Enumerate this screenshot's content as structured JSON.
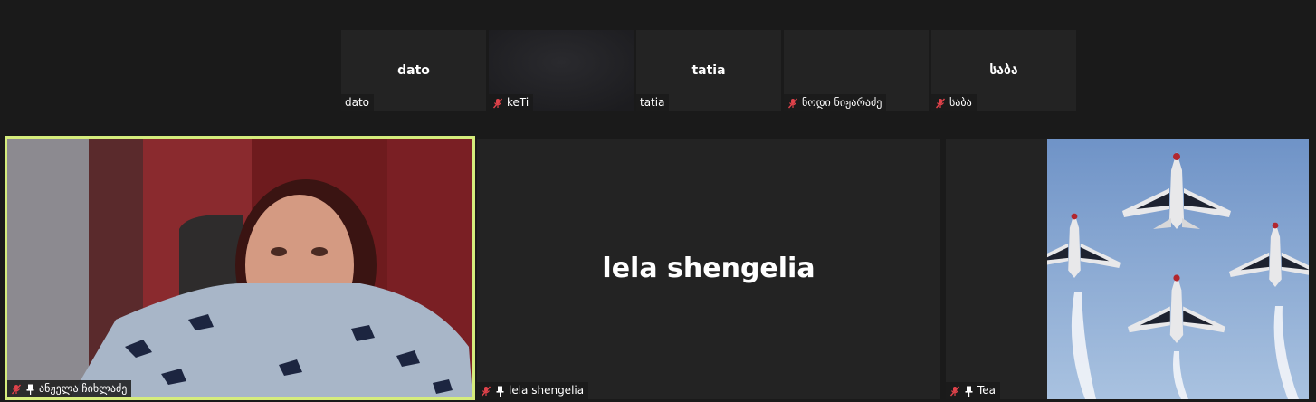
{
  "top_strip": [
    {
      "center_name": "dato",
      "label": "dato",
      "muted": false,
      "video": false
    },
    {
      "center_name": "",
      "label": "keTi",
      "muted": true,
      "video": true
    },
    {
      "center_name": "tatia",
      "label": "tatia",
      "muted": false,
      "video": false
    },
    {
      "center_name": "",
      "label": "ნოდი ნიჟარაძე",
      "muted": true,
      "video": false
    },
    {
      "center_name": "საბა",
      "label": "საბა",
      "muted": true,
      "video": false
    }
  ],
  "main": [
    {
      "label": "ანჟელა ჩიხლაძე",
      "muted": true,
      "pinned": true,
      "active_speaker": true,
      "video": true
    },
    {
      "center_name": "lela shengelia",
      "label": "lela shengelia",
      "muted": true,
      "pinned": true,
      "video": false
    },
    {
      "label": "Tea",
      "muted": true,
      "pinned": true,
      "video": true
    }
  ],
  "colors": {
    "background": "#1a1a1a",
    "tile": "#232323",
    "active_speaker_border": "#d5ec7c",
    "muted_icon": "#e0424a"
  },
  "icons": [
    "mic-muted-icon",
    "pin-icon"
  ]
}
